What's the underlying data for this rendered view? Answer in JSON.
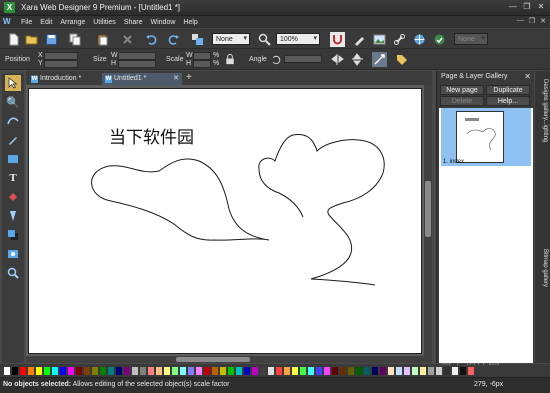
{
  "window": {
    "title": "Xara Web Designer 9 Premium - [Untitled1 *]",
    "app_icon_label": "X",
    "controls": {
      "minimize": "—",
      "restore": "❐",
      "close": "✕"
    }
  },
  "menubar": {
    "logo": "W",
    "items": [
      "File",
      "Edit",
      "Arrange",
      "Utilities",
      "Share",
      "Window",
      "Help"
    ],
    "right_controls": [
      "—",
      "❐",
      "✕"
    ]
  },
  "toolbar": {
    "blend_select": "None",
    "zoom_select": "100%",
    "disabled_field": "None"
  },
  "infobar": {
    "position_label": "Position",
    "x_label": "X",
    "y_label": "Y",
    "size_label": "Size",
    "w_label": "W",
    "h_label": "H",
    "scale_label": "Scale",
    "percent": "%",
    "angle_label": "Angle"
  },
  "tabs": [
    {
      "label": "Introduction *",
      "icon": "W"
    },
    {
      "label": "Untitled1 *",
      "icon": "W"
    }
  ],
  "tab_close": "✕",
  "tab_add": "+",
  "canvas": {
    "text": "当下软件园"
  },
  "gallery": {
    "title": "Page & Layer Gallery",
    "buttons": {
      "new_page": "New page",
      "duplicate": "Duplicate",
      "delete": "Delete",
      "help": "Help..."
    },
    "page_label": "1. index",
    "close": "✕"
  },
  "side_tabs": [
    "Designs gallery...ighting",
    "Bitmap gallery"
  ],
  "status": {
    "message": "No objects selected: Allows editing of the selected object(s) scale factor",
    "message_bold": "No objects selected:",
    "message_rest": " Allows editing of the selected object(s) scale factor",
    "coords": "279, -6px"
  },
  "watermark": "当下软件园",
  "colors": {
    "accent": "#2f8f3a",
    "selection": "#8fc2f2",
    "palette": [
      "#ffffff",
      "#000000",
      "#ff0000",
      "#ff7f00",
      "#ffff00",
      "#00ff00",
      "#00ffff",
      "#0000ff",
      "#ff00ff",
      "#7f0000",
      "#7f3f00",
      "#7f7f00",
      "#007f00",
      "#007f7f",
      "#00007f",
      "#7f007f",
      "#bfbfbf",
      "#808080",
      "#ff8080",
      "#ffbf80",
      "#ffff80",
      "#80ff80",
      "#80ffff",
      "#8080ff",
      "#ff80ff",
      "#c00000",
      "#c06000",
      "#c0c000",
      "#00c000",
      "#00c0c0",
      "#0000c0",
      "#c000c0",
      "#404040",
      "#e0e0e0",
      "#ff4040",
      "#ffa040",
      "#ffff40",
      "#40ff40",
      "#40ffff",
      "#4040ff",
      "#ff40ff",
      "#600000",
      "#603000",
      "#606000",
      "#006000",
      "#006060",
      "#000060",
      "#600060",
      "#ffe0c0",
      "#c0e0ff",
      "#e0c0ff",
      "#c0ffc0",
      "#fff0a0",
      "#a0a0a0",
      "#d0d0d0",
      "#303030",
      "#f0f0f0",
      "#101010",
      "#ff6060"
    ]
  }
}
